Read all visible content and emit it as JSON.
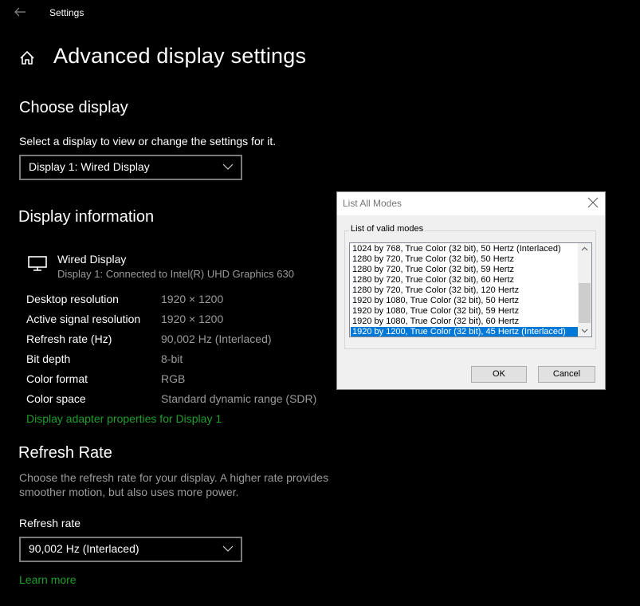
{
  "window": {
    "title": "Settings"
  },
  "page": {
    "title": "Advanced display settings"
  },
  "choose_display": {
    "heading": "Choose display",
    "description": "Select a display to view or change the settings for it.",
    "selected": "Display 1: Wired Display"
  },
  "display_info": {
    "heading": "Display information",
    "monitor_name": "Wired Display",
    "monitor_subtitle": "Display 1: Connected to Intel(R) UHD Graphics 630",
    "rows": [
      {
        "label": "Desktop resolution",
        "value": "1920 × 1200"
      },
      {
        "label": "Active signal resolution",
        "value": "1920 × 1200"
      },
      {
        "label": "Refresh rate (Hz)",
        "value": "90,002 Hz (Interlaced)"
      },
      {
        "label": "Bit depth",
        "value": "8-bit"
      },
      {
        "label": "Color format",
        "value": "RGB"
      },
      {
        "label": "Color space",
        "value": "Standard dynamic range (SDR)"
      }
    ],
    "adapter_link": "Display adapter properties for Display 1"
  },
  "refresh_rate": {
    "heading": "Refresh Rate",
    "description_line1": "Choose the refresh rate for your display. A higher rate provides",
    "description_line2": "smoother motion, but also uses more power.",
    "label": "Refresh rate",
    "selected": "90,002 Hz (Interlaced)",
    "learn_more": "Learn more"
  },
  "dialog": {
    "title": "List All Modes",
    "group_label": "List of valid modes",
    "modes": [
      "1024 by 768, True Color (32 bit), 50 Hertz (Interlaced)",
      "1280 by 720, True Color (32 bit), 50 Hertz",
      "1280 by 720, True Color (32 bit), 59 Hertz",
      "1280 by 720, True Color (32 bit), 60 Hertz",
      "1280 by 720, True Color (32 bit), 120 Hertz",
      "1920 by 1080, True Color (32 bit), 50 Hertz",
      "1920 by 1080, True Color (32 bit), 59 Hertz",
      "1920 by 1080, True Color (32 bit), 60 Hertz",
      "1920 by 1200, True Color (32 bit), 45 Hertz (Interlaced)"
    ],
    "selected_index": 8,
    "ok_label": "OK",
    "cancel_label": "Cancel"
  },
  "colors": {
    "accent_link": "#1e9e2a",
    "selection": "#0078d7"
  }
}
